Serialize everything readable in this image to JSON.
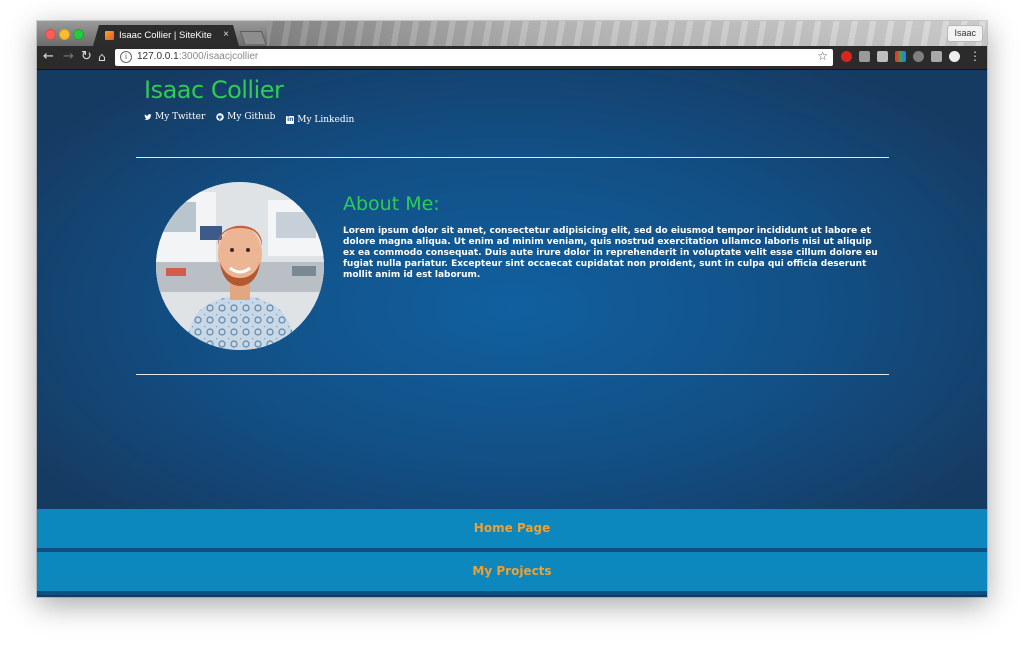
{
  "browser": {
    "tab_title": "Isaac Collier | SiteKite",
    "tab_close": "×",
    "profile_name": "Isaac",
    "url_host": "127.0.0.1",
    "url_path": ":3000/isaacjcollier"
  },
  "site": {
    "name": "Isaac Collier",
    "social_links": [
      {
        "icon": "twitter-icon",
        "label": "My Twitter"
      },
      {
        "icon": "github-icon",
        "label": "My Github"
      },
      {
        "icon": "linkedin-icon",
        "label": "My Linkedin"
      }
    ]
  },
  "about": {
    "title": "About Me:",
    "body": "Lorem ipsum dolor sit amet, consectetur adipisicing elit, sed do eiusmod tempor incididunt ut labore et dolore magna aliqua. Ut enim ad minim veniam, quis nostrud exercitation ullamco laboris nisi ut aliquip ex ea commodo consequat. Duis aute irure dolor in reprehenderit in voluptate velit esse cillum dolore eu fugiat nulla pariatur. Excepteur sint occaecat cupidatat non proident, sunt in culpa qui officia deserunt mollit anim id est laborum."
  },
  "nav": {
    "home_label": "Home Page",
    "projects_label": "My Projects"
  },
  "colors": {
    "accent_green": "#2ecc52",
    "page_blue": "#124f85",
    "nav_blue": "#0c88bf",
    "nav_text_orange": "#f0a030"
  }
}
